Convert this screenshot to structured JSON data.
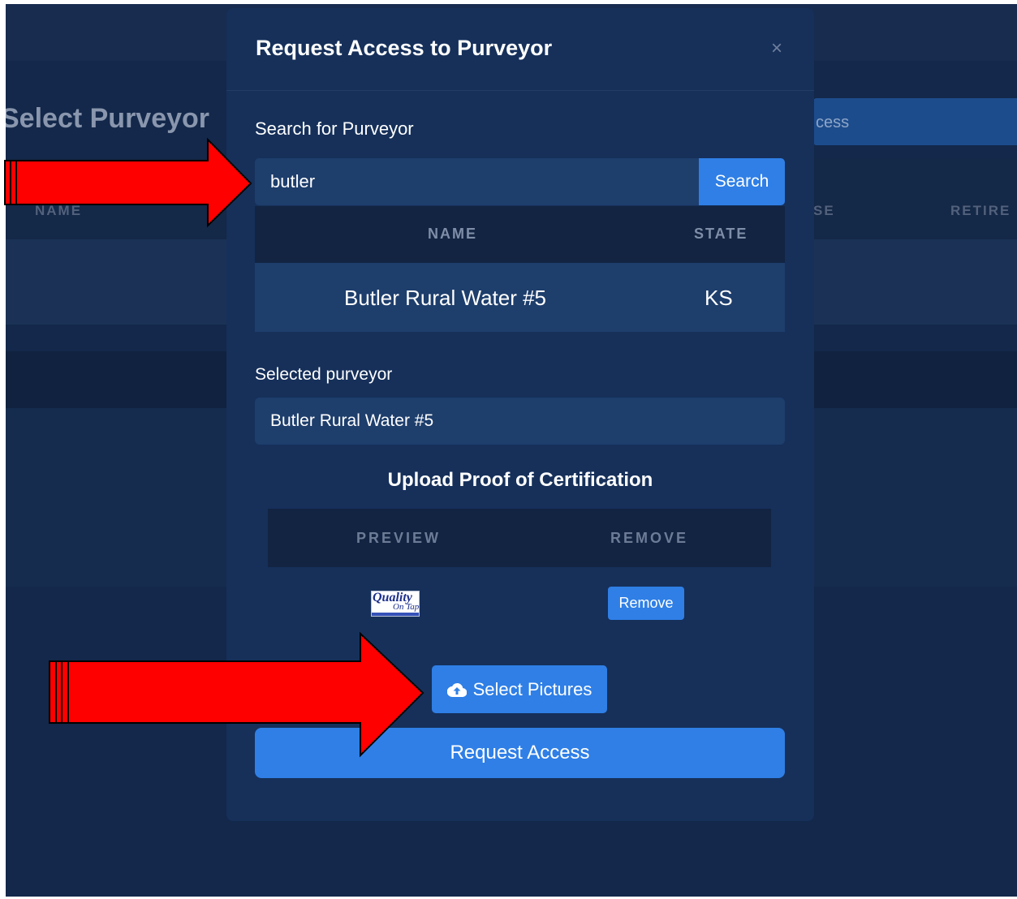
{
  "background": {
    "page_title": "Select Purveyor",
    "access_button_fragment": "cess",
    "columns": [
      "NAME",
      "SE",
      "RETIRE"
    ]
  },
  "modal": {
    "title": "Request Access to Purveyor",
    "close_glyph": "×",
    "search_label": "Search for Purveyor",
    "search_value": "butler",
    "search_button": "Search",
    "results": {
      "headers": [
        "NAME",
        "STATE"
      ],
      "rows": [
        {
          "name": "Butler Rural Water #5",
          "state": "KS"
        }
      ]
    },
    "selected_label": "Selected purveyor",
    "selected_value": "Butler Rural Water #5",
    "upload_title": "Upload Proof of Certification",
    "preview": {
      "headers": [
        "PREVIEW",
        "REMOVE"
      ],
      "thumbnail_text": "Quality",
      "thumbnail_subtext": "On Tap",
      "remove_button": "Remove"
    },
    "select_pictures_button": "Select Pictures",
    "request_access_button": "Request Access"
  },
  "colors": {
    "backdrop": "#13284a",
    "modal": "#16305a",
    "input": "#1e3e6c",
    "accent": "#2f7fe6",
    "annotation_arrow": "#ff0000"
  },
  "icons": {
    "close": "close-icon",
    "upload": "cloud-upload-icon"
  }
}
